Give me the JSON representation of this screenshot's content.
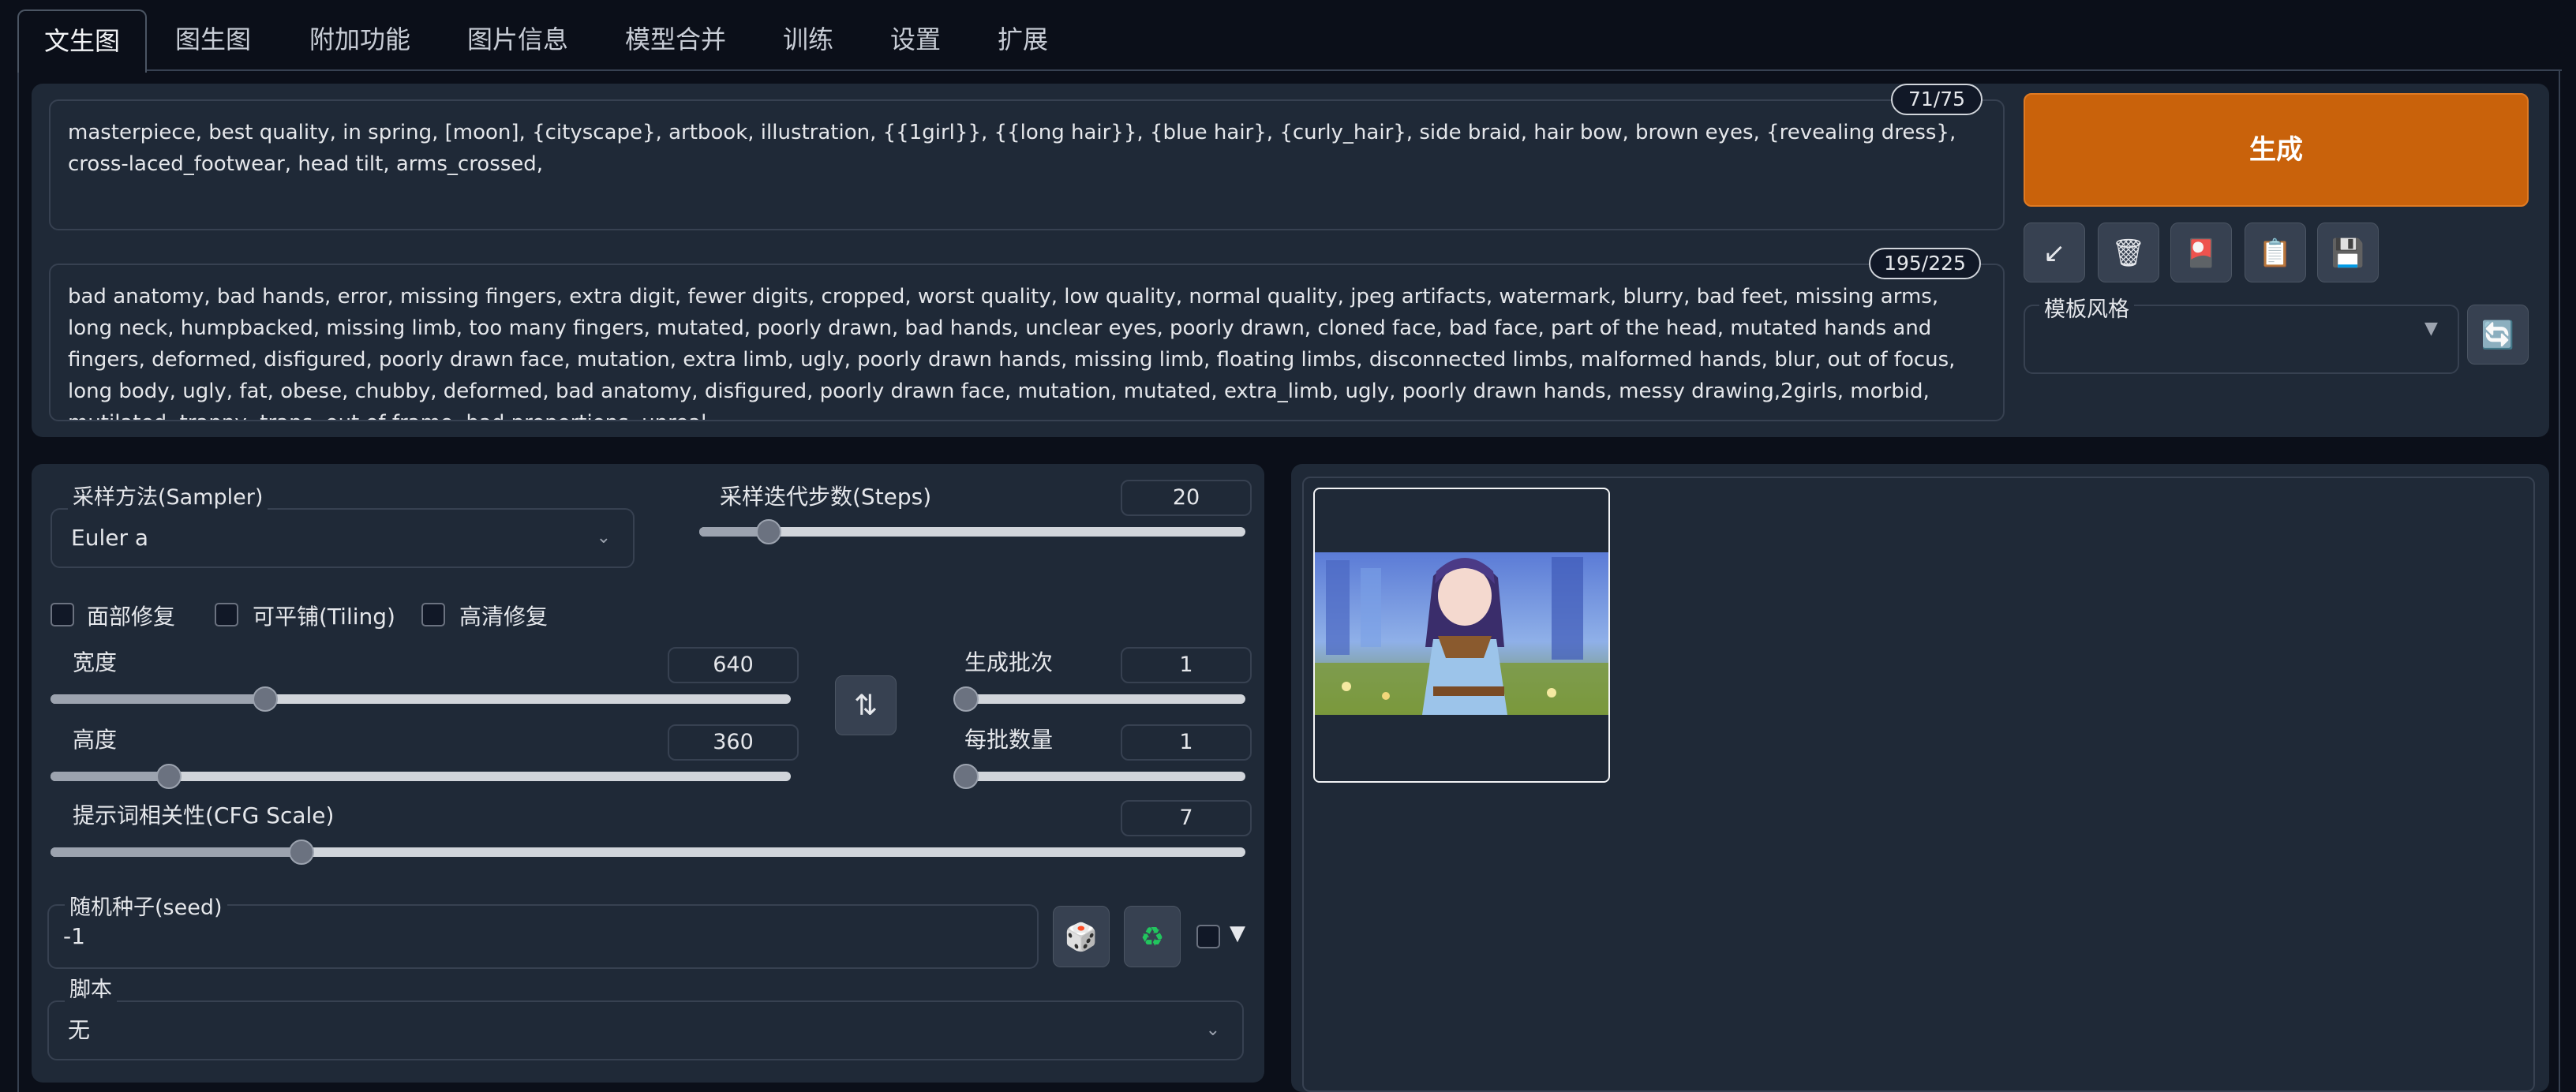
{
  "tabs": [
    "文生图",
    "图生图",
    "附加功能",
    "图片信息",
    "模型合并",
    "训练",
    "设置",
    "扩展"
  ],
  "prompt": {
    "positive_text": "masterpiece, best quality, in spring, [moon], {cityscape}, artbook, illustration, {{1girl}}, {{long hair}}, {blue hair}, {curly_hair}, side braid, hair bow, brown eyes, {revealing dress}, cross-laced_footwear, head tilt, arms_crossed,",
    "positive_counter": "71/75",
    "negative_text": "bad anatomy, bad hands, error, missing fingers, extra digit, fewer digits, cropped, worst quality, low quality, normal quality, jpeg artifacts, watermark, blurry, bad feet, missing arms, long neck, humpbacked, missing limb, too many fingers, mutated, poorly drawn, bad hands, unclear eyes, poorly drawn, cloned face, bad face, part of the head, mutated hands and fingers, deformed, disfigured, poorly drawn face, mutation, extra limb, ugly, poorly drawn hands, missing limb, floating limbs, disconnected limbs, malformed hands, blur, out of focus, long body, ugly, fat, obese, chubby, deformed, bad anatomy, disfigured, poorly drawn face, mutation, mutated, extra_limb, ugly, poorly drawn hands, messy drawing,2girls, morbid, mutilated, tranny, trans, out of frame, bad proportions, unreal,",
    "negative_counter": "195/225"
  },
  "actions": {
    "generate_label": "生成",
    "tool_icons": [
      "↙",
      "🗑",
      "🎴",
      "📋",
      "💾"
    ],
    "style_label": "模板风格",
    "style_value": "",
    "refresh_icon": "🔄"
  },
  "settings": {
    "sampler_label": "采样方法(Sampler)",
    "sampler_value": "Euler a",
    "steps_label": "采样迭代步数(Steps)",
    "steps_value": "20",
    "steps_fraction": 0.127,
    "face_restore_label": "面部修复",
    "tiling_label": "可平铺(Tiling)",
    "hires_label": "高清修复",
    "width_label": "宽度",
    "width_value": "640",
    "width_fraction": 0.29,
    "height_label": "高度",
    "height_value": "360",
    "height_fraction": 0.16,
    "swap_icon": "⇅",
    "batch_count_label": "生成批次",
    "batch_count_value": "1",
    "batch_count_fraction": 0.0,
    "batch_size_label": "每批数量",
    "batch_size_value": "1",
    "batch_size_fraction": 0.0,
    "cfg_label": "提示词相关性(CFG Scale)",
    "cfg_value": "7",
    "cfg_fraction": 0.21,
    "seed_label": "随机种子(seed)",
    "seed_value": "-1",
    "dice_icon": "🎲",
    "recycle_icon": "♻",
    "extra_toggle": "▼",
    "script_label": "脚本",
    "script_value": "无"
  }
}
